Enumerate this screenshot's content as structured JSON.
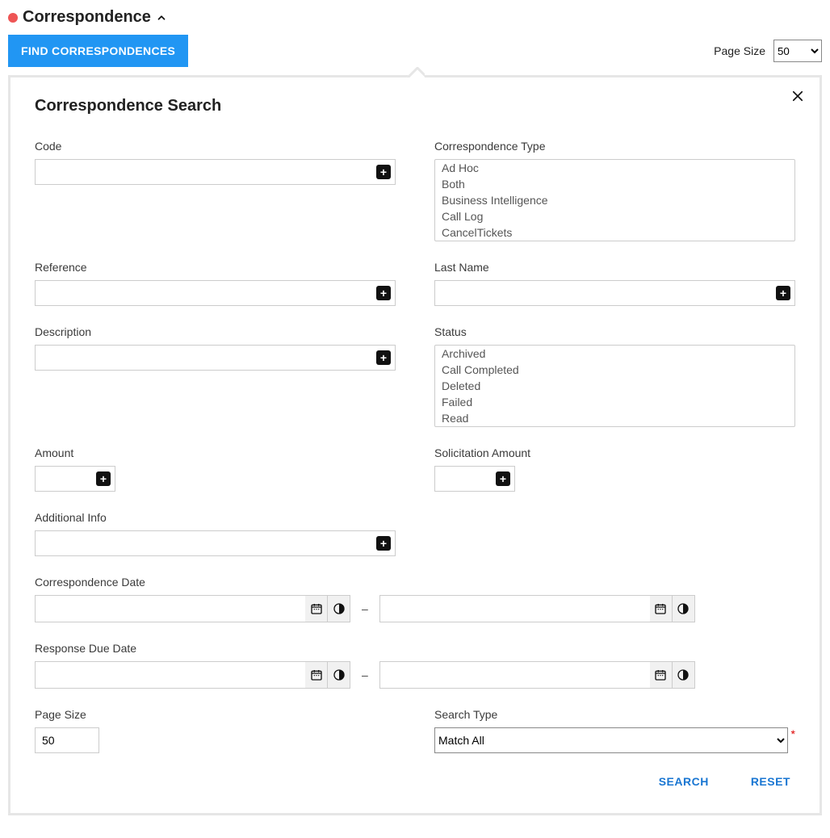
{
  "header": {
    "title": "Correspondence",
    "find_button": "FIND CORRESPONDENCES",
    "page_size_label": "Page Size",
    "page_size_value": "50"
  },
  "panel": {
    "title": "Correspondence Search"
  },
  "labels": {
    "code": "Code",
    "corr_type": "Correspondence Type",
    "reference": "Reference",
    "last_name": "Last Name",
    "description": "Description",
    "status": "Status",
    "amount": "Amount",
    "solicitation_amount": "Solicitation Amount",
    "additional_info": "Additional Info",
    "correspondence_date": "Correspondence Date",
    "response_due_date": "Response Due Date",
    "page_size": "Page Size",
    "search_type": "Search Type"
  },
  "values": {
    "code": "",
    "reference": "",
    "last_name": "",
    "description": "",
    "amount": "",
    "solicitation_amount": "",
    "additional_info": "",
    "corr_date_from": "",
    "corr_date_to": "",
    "resp_date_from": "",
    "resp_date_to": "",
    "page_size": "50",
    "search_type": "Match All"
  },
  "correspondence_types": [
    "Ad Hoc",
    "Both",
    "Business Intelligence",
    "Call Log",
    "CancelTickets"
  ],
  "statuses": [
    "Archived",
    "Call Completed",
    "Deleted",
    "Failed",
    "Read"
  ],
  "actions": {
    "search": "SEARCH",
    "reset": "RESET"
  },
  "glyphs": {
    "plus": "+",
    "dash": "–",
    "required": "*"
  }
}
